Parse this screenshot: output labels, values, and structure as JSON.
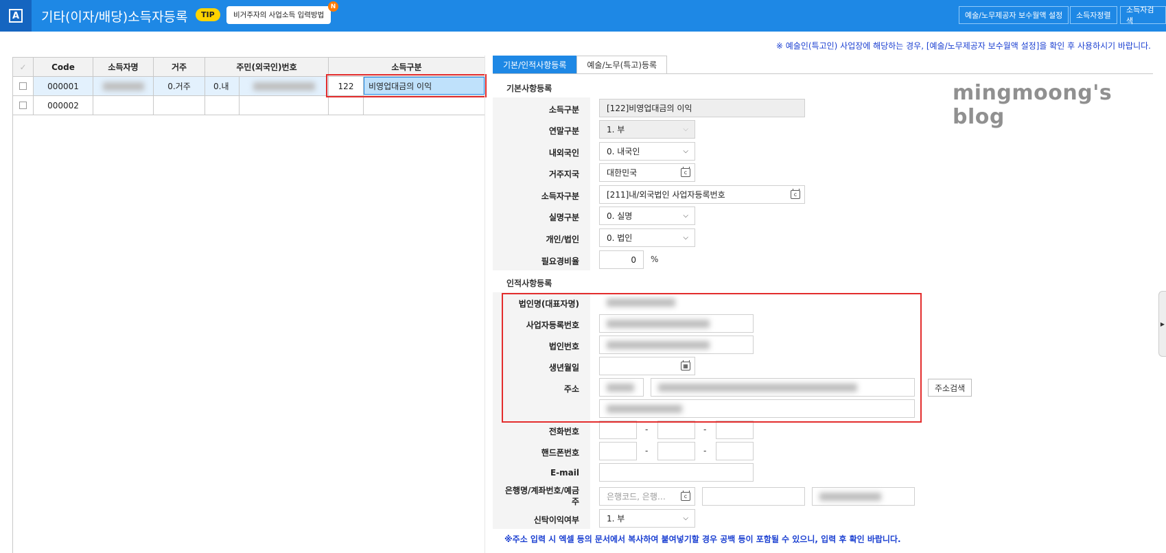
{
  "header": {
    "app_icon": "A",
    "title": "기타(이자/배당)소득자등록",
    "tip_label": "TIP",
    "tip_text": "비거주자의 사업소득 입력방법",
    "tip_new": "N",
    "buttons": [
      "예술/노무제공자 보수월액 설정",
      "소득자정렬",
      "소득자검색"
    ]
  },
  "notice_top": "※ 예술인(특고인) 사업장에 해당하는 경우, [예술/노무제공자 보수월액 설정]을 확인 후 사용하시기 바랍니다.",
  "grid": {
    "columns": [
      "Code",
      "소득자명",
      "거주",
      "주민(외국인)번호",
      "소득구분"
    ],
    "rows": [
      {
        "code": "000001",
        "resident": "0.거주",
        "foreign": "0.내",
        "income_code": "122",
        "income_name": "비영업대금의 이익"
      },
      {
        "code": "000002",
        "resident": "",
        "foreign": "",
        "income_code": "",
        "income_name": ""
      }
    ]
  },
  "tabs": [
    "기본/인적사항등록",
    "예술/노무(특고)등록"
  ],
  "basic": {
    "section_title": "기본사항등록",
    "income_type": {
      "label": "소득구분",
      "value": "[122]비영업대금의 이익"
    },
    "year_end": {
      "label": "연말구분",
      "value": "1. 부"
    },
    "domestic": {
      "label": "내외국인",
      "value": "0. 내국인"
    },
    "country": {
      "label": "거주지국",
      "value": "대한민국"
    },
    "earner_type": {
      "label": "소득자구분",
      "value": "[211]내/외국법인 사업자등록번호"
    },
    "realname": {
      "label": "실명구분",
      "value": "0. 실명"
    },
    "person_corp": {
      "label": "개인/법인",
      "value": "0. 법인"
    },
    "expense_rate": {
      "label": "필요경비율",
      "value": "0",
      "unit": "%"
    }
  },
  "personal": {
    "section_title": "인적사항등록",
    "corp_name": {
      "label": "법인명(대표자명)"
    },
    "biz_no": {
      "label": "사업자등록번호"
    },
    "corp_no": {
      "label": "법인번호"
    },
    "birth": {
      "label": "생년월일"
    },
    "address": {
      "label": "주소",
      "search_button": "주소검색"
    },
    "phone": {
      "label": "전화번호"
    },
    "mobile": {
      "label": "핸드폰번호"
    },
    "email": {
      "label": "E-mail"
    },
    "bank": {
      "label": "은행명/계좌번호/예금주",
      "placeholder": "은행코드, 은행…"
    },
    "trust": {
      "label": "신탁이익여부",
      "value": "1. 부"
    }
  },
  "notice_bottom": "※주소 입력 시 엑셀 등의 문서에서 복사하여 붙여넣기할 경우 공백 등이 포함될 수 있으니, 입력 후 확인 바랍니다.",
  "watermark": "mingmoong's blog",
  "colors": {
    "header": "#1e88e5",
    "accent": "#1a3fd1",
    "highlight": "#e32c2c"
  }
}
